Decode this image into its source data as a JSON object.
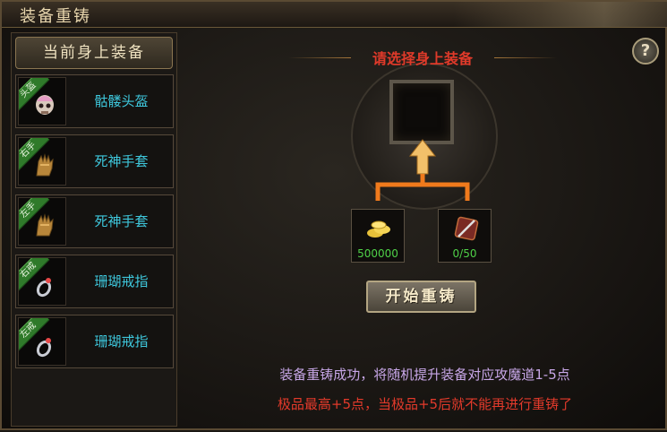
{
  "window": {
    "title": "装备重铸"
  },
  "left_panel": {
    "header": "当前身上装备",
    "slots": [
      {
        "tag": "头盔",
        "name": "骷髅头盔",
        "icon": "skull-helmet-icon"
      },
      {
        "tag": "右手",
        "name": "死神手套",
        "icon": "gauntlet-icon"
      },
      {
        "tag": "左手",
        "name": "死神手套",
        "icon": "gauntlet-icon"
      },
      {
        "tag": "右戒",
        "name": "珊瑚戒指",
        "icon": "ring-icon"
      },
      {
        "tag": "左戒",
        "name": "珊瑚戒指",
        "icon": "ring-icon"
      }
    ]
  },
  "main": {
    "help_label": "?",
    "select_prompt": "请选择身上装备",
    "costs": [
      {
        "icon": "gold-coins-icon",
        "value": "500000"
      },
      {
        "icon": "sword-material-icon",
        "value": "0/50"
      }
    ],
    "start_button": "开始重铸",
    "info_line1": "装备重铸成功，将随机提升装备对应攻魔道1-5点",
    "info_line2": "极品最高+5点，当极品+5后就不能再进行重铸了"
  },
  "colors": {
    "accent_title": "#e03a2a",
    "slot_name": "#3ec7dc",
    "cost_text": "#4fd148",
    "info1": "#c8a7e8",
    "info2": "#e33a2b",
    "tag_green": "#2f7a2a"
  }
}
